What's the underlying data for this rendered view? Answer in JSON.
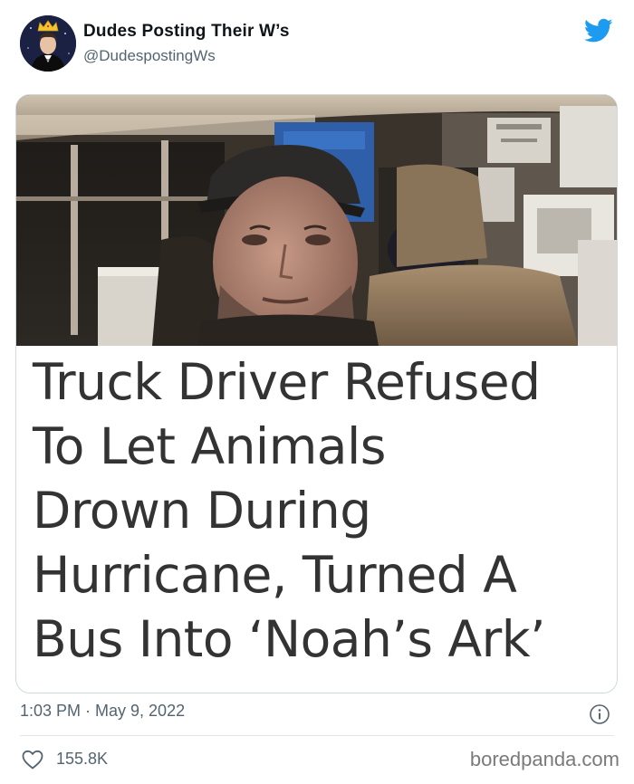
{
  "tweet": {
    "author_name": "Dudes Posting Their W’s",
    "author_handle": "@DudespostingWs",
    "headline_lines": [
      "Truck Driver Refused",
      "To Let Animals",
      "Drown During",
      "Hurricane, Turned A",
      "Bus Into ‘Noah’s Ark’"
    ],
    "timestamp": "1:03 PM · May 9, 2022",
    "likes": "155.8K",
    "icons": {
      "platform": "twitter-bird-icon",
      "info": "info-icon",
      "like": "heart-icon"
    }
  },
  "watermark": "boredpanda.com",
  "colors": {
    "twitter_blue": "#1d9bf0",
    "secondary_text": "#536471",
    "headline_text": "#333333",
    "card_border": "#cfd9de"
  }
}
